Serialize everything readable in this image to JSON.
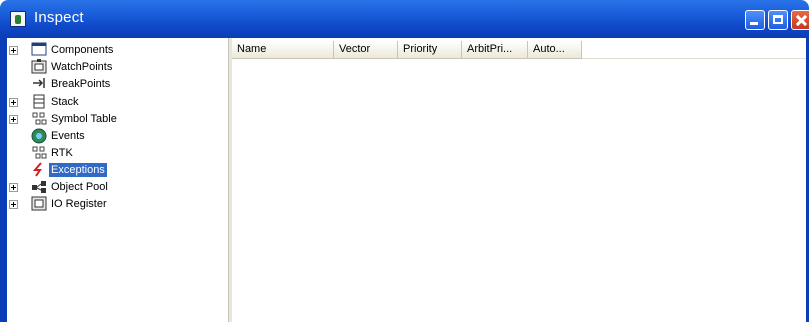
{
  "window": {
    "title": "Inspect",
    "icon": "inspect-app-icon",
    "controls": [
      "minimize",
      "maximize",
      "close"
    ]
  },
  "tree": {
    "items": [
      {
        "label": "Components",
        "icon": "components-icon",
        "expandable": true,
        "selected": false
      },
      {
        "label": "WatchPoints",
        "icon": "watchpoints-icon",
        "expandable": false,
        "selected": false
      },
      {
        "label": "BreakPoints",
        "icon": "breakpoints-arrow-icon",
        "expandable": false,
        "selected": false
      },
      {
        "label": "Stack",
        "icon": "stack-icon",
        "expandable": true,
        "selected": false
      },
      {
        "label": "Symbol Table",
        "icon": "symbol-table-icon",
        "expandable": true,
        "selected": false
      },
      {
        "label": "Events",
        "icon": "events-icon",
        "expandable": false,
        "selected": false
      },
      {
        "label": "RTK",
        "icon": "rtk-icon",
        "expandable": false,
        "selected": false
      },
      {
        "label": "Exceptions",
        "icon": "exceptions-lightning-icon",
        "expandable": false,
        "selected": true
      },
      {
        "label": "Object Pool",
        "icon": "object-pool-icon",
        "expandable": true,
        "selected": false
      },
      {
        "label": "IO Register",
        "icon": "io-register-icon",
        "expandable": true,
        "selected": false
      }
    ]
  },
  "list": {
    "columns": [
      "Name",
      "Vector",
      "Priority",
      "ArbitPri...",
      "Auto..."
    ],
    "rows": []
  },
  "colors": {
    "titlebar": "#0b3db6",
    "selection": "#316ac5",
    "header": "#ece9d8"
  }
}
